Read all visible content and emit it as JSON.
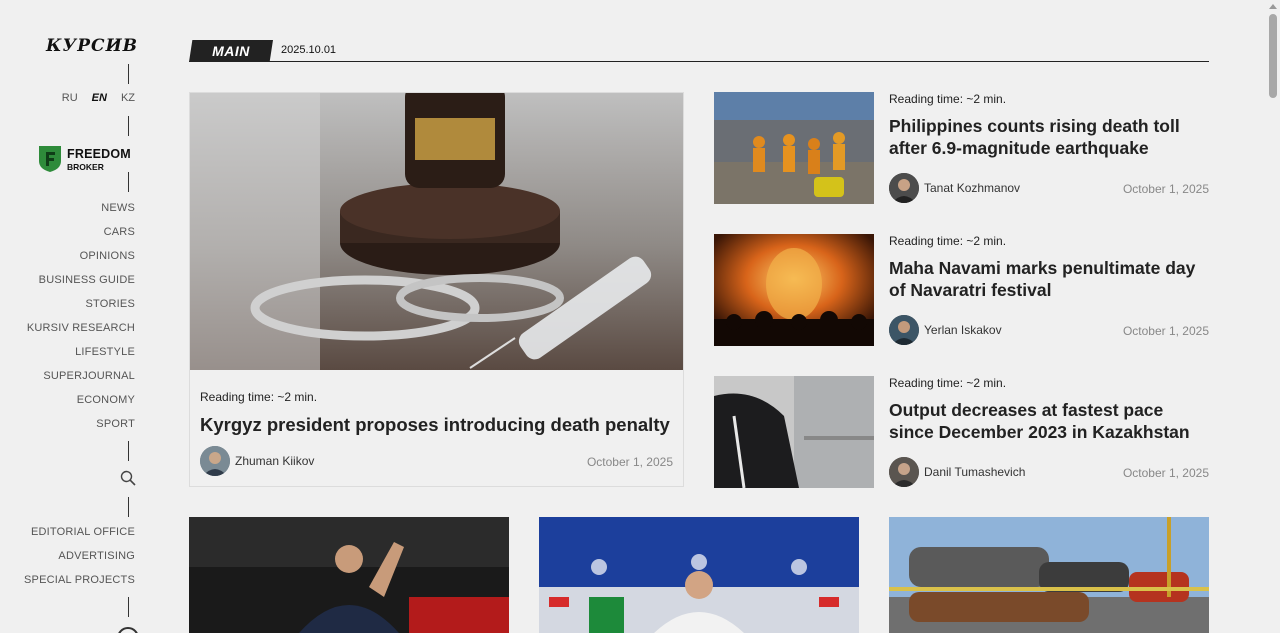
{
  "sidebar": {
    "logo": "КУРСИВ",
    "langs": [
      "RU",
      "EN",
      "KZ"
    ],
    "broker": {
      "line1": "FREEDOM",
      "line2": "BROKER"
    },
    "nav": [
      "NEWS",
      "CARS",
      "OPINIONS",
      "BUSINESS GUIDE",
      "STORIES",
      "KURSIV RESEARCH",
      "LIFESTYLE",
      "SUPERJOURNAL",
      "ECONOMY",
      "SPORT"
    ],
    "footer_nav": [
      "EDITORIAL OFFICE",
      "ADVERTISING",
      "SPECIAL PROJECTS"
    ]
  },
  "header": {
    "tab": "MAIN",
    "date": "2025.10.01"
  },
  "featured": {
    "reading": "Reading time: ~2 min.",
    "title": "Kyrgyz president proposes introducing death penalty",
    "author": "Zhuman Kiikov",
    "date": "October 1, 2025"
  },
  "side_articles": [
    {
      "reading": "Reading time: ~2 min.",
      "title": "Philippines counts rising death toll after 6.9-magnitude earthquake",
      "author": "Tanat Kozhmanov",
      "date": "October 1, 2025"
    },
    {
      "reading": "Reading time: ~2 min.",
      "title": "Maha Navami marks penultimate day of Navaratri festival",
      "author": "Yerlan Iskakov",
      "date": "October 1, 2025"
    },
    {
      "reading": "Reading time: ~2 min.",
      "title": "Output decreases at fastest pace since December 2023 in Kazakhstan",
      "author": "Danil Tumashevich",
      "date": "October 1, 2025"
    }
  ],
  "colors": {
    "background": "#f0f0f0",
    "accent": "#222222",
    "muted": "#888888",
    "broker_green": "#2e8b3a"
  }
}
